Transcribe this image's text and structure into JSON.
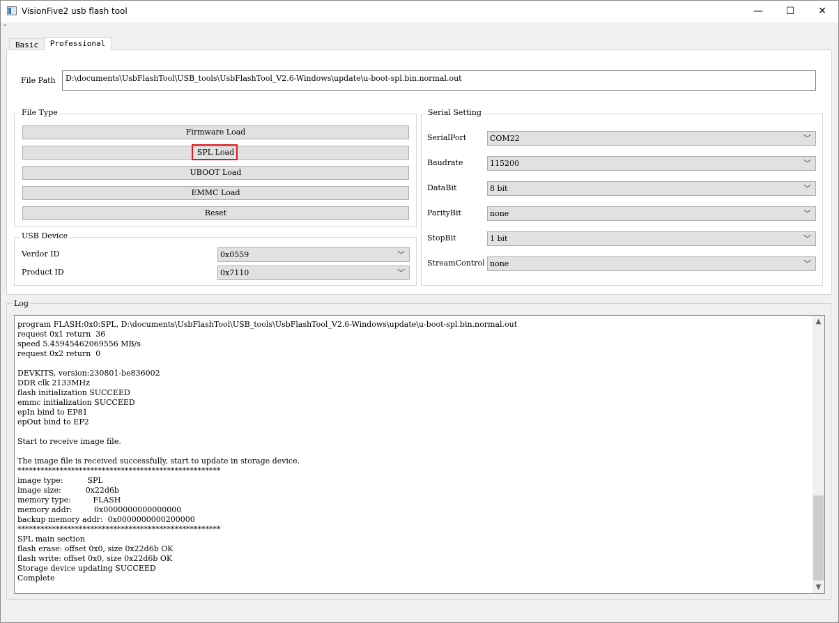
{
  "window": {
    "title": "VisionFive2 usb flash tool",
    "minimize": "—",
    "maximize": "☐",
    "close": "✕"
  },
  "tabs": [
    {
      "label": "Basic",
      "active": false
    },
    {
      "label": "Professional",
      "active": true
    }
  ],
  "file_path": {
    "label": "File Path",
    "value": "D:\\documents\\UsbFlashTool\\USB_tools\\UsbFlashTool_V2.6-Windows\\update\\u-boot-spl.bin.normal.out"
  },
  "file_type": {
    "title": "File Type",
    "buttons": [
      "Firmware Load",
      "SPL Load",
      "UBOOT Load",
      "EMMC Load",
      "Reset"
    ]
  },
  "usb_device": {
    "title": "USB Device",
    "vendor_label": "Verdor ID",
    "vendor_value": "0x0559",
    "product_label": "Product ID",
    "product_value": "0x7110"
  },
  "serial": {
    "title": "Serial Setting",
    "fields": [
      {
        "label": "SerialPort",
        "value": "COM22"
      },
      {
        "label": "Baudrate",
        "value": "115200"
      },
      {
        "label": "DataBit",
        "value": "8 bit"
      },
      {
        "label": "ParityBit",
        "value": "none"
      },
      {
        "label": "StopBit",
        "value": "1 bit"
      },
      {
        "label": "StreamControl",
        "value": "none"
      }
    ]
  },
  "log": {
    "title": "Log",
    "lines": [
      "program FLASH:0x0:SPL, D:\\documents\\UsbFlashTool\\USB_tools\\UsbFlashTool_V2.6-Windows\\update\\u-boot-spl.bin.normal.out",
      "request 0x1 return  36",
      "speed 5.45945462069556 MB/s",
      "request 0x2 return  0",
      "",
      "DEVKITS, version:230801-be836002",
      "DDR clk 2133MHz",
      "flash initialization SUCCEED",
      "emmc initialization SUCCEED",
      "epIn bind to EP81",
      "epOut bind to EP2",
      "",
      "Start to receive image file.",
      "",
      "The image file is received successfully, start to update in storage device.",
      "*****************************************************",
      "image type:          SPL",
      "image size:          0x22d6b",
      "memory type:         FLASH",
      "memory addr:         0x0000000000000000",
      "backup memory addr:  0x0000000000200000",
      "*****************************************************",
      "SPL main section",
      "flash erase: offset 0x0, size 0x22d6b OK",
      "flash write: offset 0x0, size 0x22d6b OK",
      "Storage device updating SUCCEED",
      "Complete"
    ]
  },
  "icons": {
    "chevron": "﹀",
    "scroll_up": "▲",
    "scroll_down": "▼"
  }
}
